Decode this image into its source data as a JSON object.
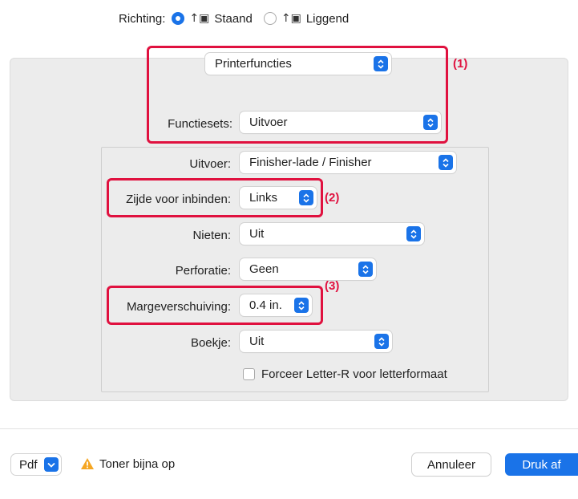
{
  "orientation": {
    "label": "Richting:",
    "portrait": "Staand",
    "landscape": "Liggend",
    "selected": "Staand",
    "portrait_icon": "portrait-orientation-icon",
    "landscape_icon": "landscape-orientation-icon"
  },
  "panel_select": {
    "value": "Printerfuncties"
  },
  "feature_sets": {
    "label": "Functiesets:",
    "value": "Uitvoer"
  },
  "options": {
    "output": {
      "label": "Uitvoer:",
      "value": "Finisher-lade / Finisher"
    },
    "binding": {
      "label": "Zijde voor inbinden:",
      "value": "Links"
    },
    "staple": {
      "label": "Nieten:",
      "value": "Uit"
    },
    "punch": {
      "label": "Perforatie:",
      "value": "Geen"
    },
    "margin_shift": {
      "label": "Margeverschuiving:",
      "value": "0.4 in."
    },
    "booklet": {
      "label": "Boekje:",
      "value": "Uit"
    },
    "force_letter_r": {
      "label": "Forceer Letter-R voor letterformaat",
      "checked": false
    }
  },
  "annotations": {
    "a1": "(1)",
    "a2": "(2)",
    "a3": "(3)"
  },
  "footer": {
    "pdf_label": "Pdf",
    "warning_text": "Toner bijna op",
    "cancel_label": "Annuleer",
    "print_label": "Druk af"
  },
  "colors": {
    "accent": "#1a73e8",
    "highlight": "#e0113f",
    "warning": "#f5a623"
  }
}
